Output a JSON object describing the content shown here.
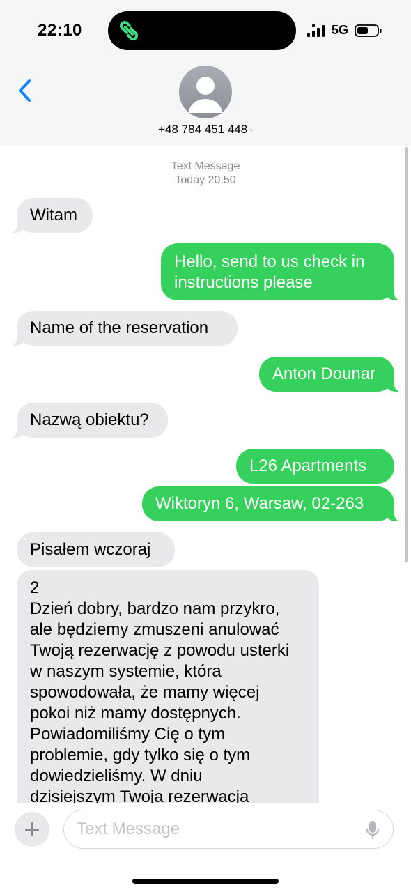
{
  "status_bar": {
    "time": "22:10",
    "network": "5G",
    "island_icon": "link-chain-icon",
    "icons": [
      "signal-bars-icon",
      "battery-icon"
    ]
  },
  "header": {
    "back_icon": "chevron-left-icon",
    "avatar_icon": "person-silhouette-icon",
    "contact_number": "+48 784 451 448",
    "contact_chevron": "›"
  },
  "thread": {
    "service_label": "Text Message",
    "timestamp": "Today 20:50",
    "messages": [
      {
        "direction": "incoming",
        "text": "Witam"
      },
      {
        "direction": "outgoing",
        "text": "Hello, send to us check in instructions please"
      },
      {
        "direction": "incoming",
        "text": "Name of the reservation"
      },
      {
        "direction": "outgoing",
        "text": "Anton Dounar"
      },
      {
        "direction": "incoming",
        "text": "Nazwą obiektu?"
      },
      {
        "direction": "outgoing",
        "text": "L26 Apartments"
      },
      {
        "direction": "outgoing",
        "text": "Wiktoryn 6, Warsaw, 02-263"
      },
      {
        "direction": "incoming",
        "text": "Pisałem wczoraj"
      },
      {
        "direction": "incoming",
        "text": "2\nDzień dobry, bardzo nam przykro,\nale będziemy zmuszeni anulować\nTwoją rezerwację z powodu usterki\nw naszym systemie, która\nspowodowała, że mamy więcej\npokoi niż mamy dostępnych.\nPowiadomiliśmy Cię o tym\nproblemie, gdy tylko się o tym\ndowiedzieliśmy. W dniu\ndzisiejszym Twoja rezerwacja"
      }
    ]
  },
  "input_bar": {
    "plus_icon": "plus-icon",
    "placeholder": "Text Message",
    "mic_icon": "microphone-icon"
  },
  "colors": {
    "outgoing_bubble": "#35d15c",
    "incoming_bubble": "#e9e9eb",
    "accent_blue": "#0a84ff",
    "island_icon_green": "#3ddc84"
  }
}
